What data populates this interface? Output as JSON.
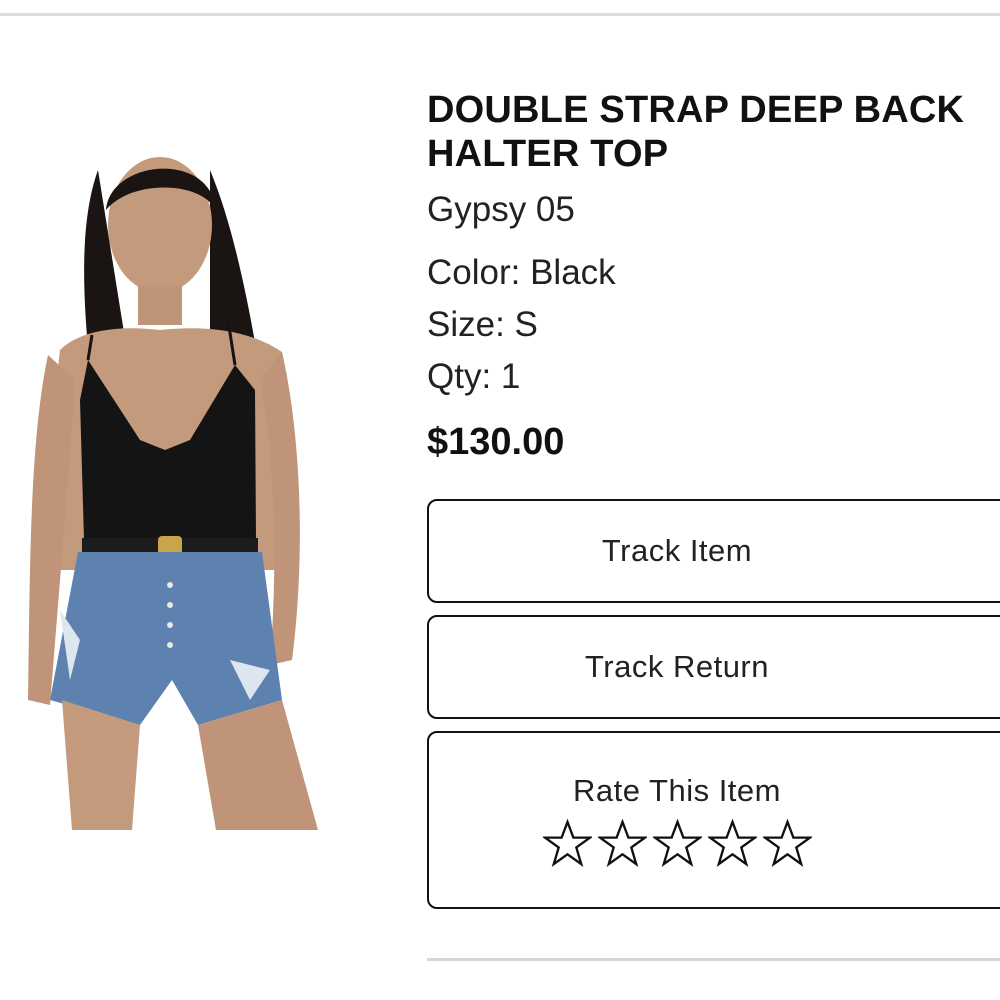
{
  "product": {
    "title": "DOUBLE STRAP DEEP BACK HALTER TOP",
    "brand": "Gypsy 05",
    "color": "Color: Black",
    "size": "Size: S",
    "qty": "Qty: 1",
    "price": "$130.00"
  },
  "actions": {
    "track_item": "Track Item",
    "track_return": "Track Return",
    "rate_item": "Rate This Item"
  },
  "rating": {
    "max_stars": 5,
    "selected_stars": 0,
    "icon": "star-outline-icon"
  },
  "colors": {
    "text": "#111111",
    "border": "#111111",
    "divider": "#dcdcdc"
  }
}
